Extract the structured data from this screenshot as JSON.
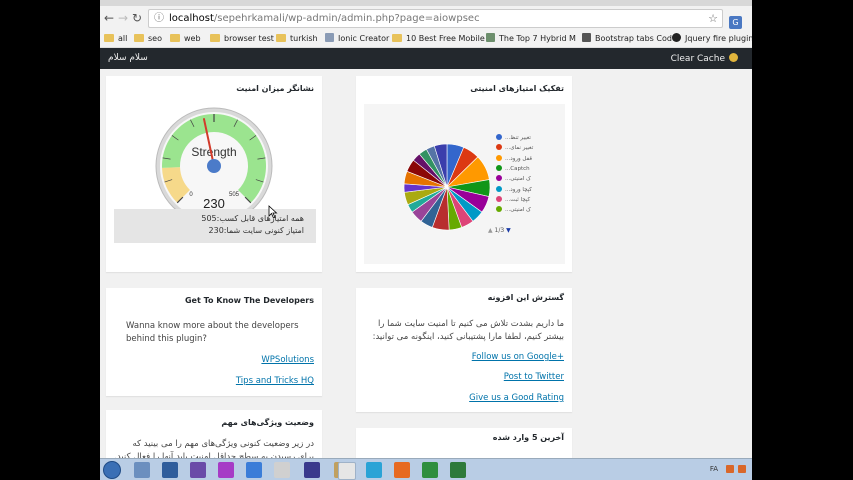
{
  "browser": {
    "url_host": "localhost",
    "url_path": "/sepehrkamali/wp-admin/admin.php?page=aiowpsec",
    "bookmarks": [
      {
        "label": "all",
        "type": "folder"
      },
      {
        "label": "seo",
        "type": "folder"
      },
      {
        "label": "web",
        "type": "folder"
      },
      {
        "label": "browser test",
        "type": "folder"
      },
      {
        "label": "turkish",
        "type": "folder"
      },
      {
        "label": "Ionic Creator",
        "type": "site"
      },
      {
        "label": "10 Best Free Mobile",
        "type": "site"
      },
      {
        "label": "The Top 7 Hybrid M",
        "type": "site"
      },
      {
        "label": "Bootstrap tabs Code",
        "type": "site"
      },
      {
        "label": "Jquery fire plugin: f",
        "type": "site"
      }
    ]
  },
  "adminbar": {
    "greeting": "سلام سلام",
    "clear_cache": "Clear Cache"
  },
  "gauge_panel": {
    "title": "نشانگر میزان امنیت",
    "gauge_label": "Strength",
    "min_label": "0",
    "max_label": "505",
    "value_label": "230",
    "value": 230,
    "max": 505,
    "info_total": "همه امتیازهای قابل کسب:505",
    "info_current": "امتیاز کنونی سایت شما:230"
  },
  "chart_panel": {
    "title": "تفکیک امتیازهای امنیتی",
    "pager": "1/3"
  },
  "chart_data": {
    "type": "pie",
    "title": "",
    "slices": [
      {
        "name": "...تغییر تنظ",
        "value": 20,
        "color": "#3366cc"
      },
      {
        "name": "...تغییر نمای",
        "value": 20,
        "color": "#dc3912"
      },
      {
        "name": "...قفل ورود",
        "value": 30,
        "color": "#ff9900"
      },
      {
        "name": "...Captch",
        "value": 20,
        "color": "#109618"
      },
      {
        "name": "...ک امنیتی",
        "value": 20,
        "color": "#990099"
      },
      {
        "name": "...کپچا ورود",
        "value": 15,
        "color": "#0099c6"
      },
      {
        "name": "...کپچا ثبت",
        "value": 15,
        "color": "#dd4477"
      },
      {
        "name": "...ک امنیتی",
        "value": 15,
        "color": "#66aa00"
      },
      {
        "name": "",
        "value": 20,
        "color": "#b82e2e"
      },
      {
        "name": "",
        "value": 15,
        "color": "#316395"
      },
      {
        "name": "",
        "value": 15,
        "color": "#994499"
      },
      {
        "name": "",
        "value": 10,
        "color": "#22aa99"
      },
      {
        "name": "",
        "value": 15,
        "color": "#aaaa11"
      },
      {
        "name": "",
        "value": 10,
        "color": "#6633cc"
      },
      {
        "name": "",
        "value": 15,
        "color": "#e67300"
      },
      {
        "name": "",
        "value": 15,
        "color": "#8b0707"
      },
      {
        "name": "",
        "value": 10,
        "color": "#651067"
      },
      {
        "name": "",
        "value": 10,
        "color": "#329262"
      },
      {
        "name": "",
        "value": 10,
        "color": "#5574a6"
      },
      {
        "name": "",
        "value": 15,
        "color": "#3b3eac"
      }
    ]
  },
  "developers_panel": {
    "title": "Get To Know The Developers",
    "text": "Wanna know more about the developers behind this plugin?",
    "link1": "WPSolutions",
    "link2": "Tips and Tricks HQ"
  },
  "spread_panel": {
    "title": "گسترش این افزونه",
    "text": "ما داریم بشدت تلاش می کنیم تا امنیت سایت شما را بیشتر کنیم، لطفا مارا پشتیبانی کنید، اینگونه می توانید:",
    "link1": "Follow us on Google+",
    "link2": "Post to Twitter",
    "link3": "Give us a Good Rating"
  },
  "features_panel": {
    "title": "وضعیت ویژگی‌های مهم",
    "text": "در زیر وضعیت کنونی ویژگی‌های مهم را می بینید که برای رسیدن به سطح حداقل امنیت باید آنها را فعال کنید."
  },
  "last5_panel": {
    "title": "آخرین 5 وارد شده"
  },
  "taskbar": {
    "lang": "FA"
  }
}
